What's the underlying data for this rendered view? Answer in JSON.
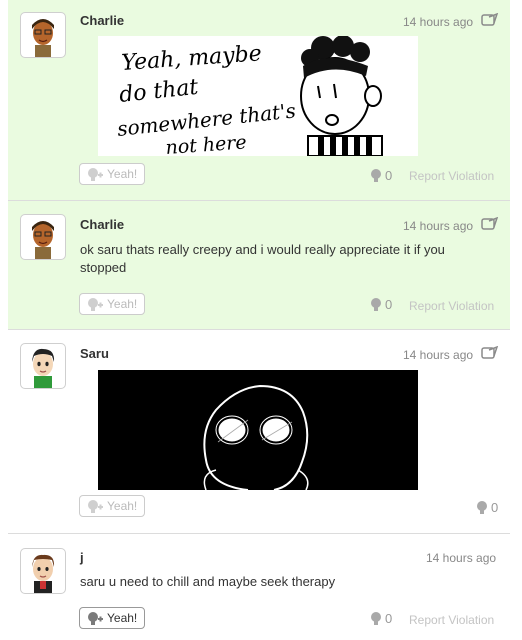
{
  "posts": [
    {
      "name": "Charlie",
      "time": "14 hours ago",
      "has_spoiler_icon": true,
      "body": "",
      "drawing_text": [
        "Yeah, maybe",
        "do that",
        "somewhere that's",
        "not here"
      ],
      "yeah_label": "Yeah!",
      "yeah_count": "0",
      "report": "Report Violation",
      "highlighted": true
    },
    {
      "name": "Charlie",
      "time": "14 hours ago",
      "has_spoiler_icon": true,
      "body": "ok saru thats really creepy and i would really appreciate it if you stopped",
      "yeah_label": "Yeah!",
      "yeah_count": "0",
      "report": "Report Violation",
      "highlighted": true
    },
    {
      "name": "Saru",
      "time": "14 hours ago",
      "has_spoiler_icon": true,
      "body": "",
      "yeah_label": "Yeah!",
      "yeah_count": "0",
      "report": "",
      "highlighted": false
    },
    {
      "name": "j",
      "time": "14 hours ago",
      "has_spoiler_icon": false,
      "body": "saru u need to chill and maybe seek therapy",
      "yeah_label": "Yeah!",
      "yeah_count": "0",
      "report": "Report Violation",
      "highlighted": false
    }
  ],
  "colors": {
    "highlight_bg": "#eafbe0",
    "text": "#333333",
    "muted": "#888888"
  }
}
